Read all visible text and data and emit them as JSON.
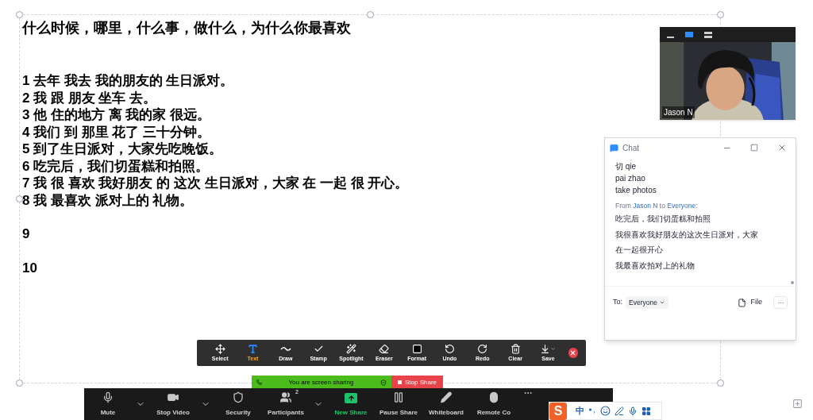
{
  "document": {
    "title": "什么时候，哪里，什么事，做什么，为什么你最喜欢",
    "lines": [
      {
        "kind": "sentence",
        "text": "1 去年 我去 我的朋友的 生日派对。"
      },
      {
        "kind": "sentence",
        "text": "2 我 跟 朋友 坐车 去。"
      },
      {
        "kind": "sentence",
        "text": "3 他 住的地方 离 我的家 很远。"
      },
      {
        "kind": "sentence",
        "text": "4 我们 到 那里 花了 三十分钟。"
      },
      {
        "kind": "sentence",
        "text": "5 到了生日派对，大家先吃晚饭。"
      },
      {
        "kind": "sentence",
        "text": "6 吃完后，我们切蛋糕和拍照。"
      },
      {
        "kind": "sentence",
        "text": "7 我 很 喜欢 我好朋友 的 这次 生日派对，大家 在 一起 很 开心。"
      },
      {
        "kind": "sentence",
        "text": "8 我 最喜欢 派对上的 礼物。"
      },
      {
        "kind": "spaced",
        "text": "9"
      },
      {
        "kind": "spaced",
        "text": "10"
      }
    ]
  },
  "video": {
    "name": "Jason N",
    "view_buttons": [
      {
        "kind": "minimize",
        "selected": false
      },
      {
        "kind": "speaker",
        "selected": true
      },
      {
        "kind": "gallery",
        "selected": false
      }
    ]
  },
  "chat": {
    "title": "Chat",
    "earlier_lines": [
      "切 qie",
      "pai zhao",
      "take photos"
    ],
    "header": {
      "from_label": "From",
      "sender": "Jason N",
      "to_label": "to",
      "recipient": "Everyone:"
    },
    "messages": [
      "吃完后，我们切蛋糕和拍照",
      "我很喜欢我好朋友的这次生日派对，大家",
      "在一起很开心",
      "我最喜欢拍对上的礼物"
    ],
    "footer": {
      "to_label": "To:",
      "recipient": "Everyone",
      "file_label": "File"
    }
  },
  "annotation_toolbar": {
    "tools": [
      {
        "kind": "select",
        "label": "Select",
        "selected": false
      },
      {
        "kind": "text",
        "label": "Text",
        "selected": true
      },
      {
        "kind": "draw",
        "label": "Draw",
        "selected": false
      },
      {
        "kind": "stamp",
        "label": "Stamp",
        "selected": false
      },
      {
        "kind": "spotlight",
        "label": "Spotlight",
        "selected": false
      },
      {
        "kind": "eraser",
        "label": "Eraser",
        "selected": false
      },
      {
        "kind": "format",
        "label": "Format",
        "selected": false
      },
      {
        "kind": "undo",
        "label": "Undo",
        "selected": false
      },
      {
        "kind": "redo",
        "label": "Redo",
        "selected": false
      },
      {
        "kind": "clear",
        "label": "Clear",
        "selected": false
      },
      {
        "kind": "save",
        "label": "Save",
        "selected": false
      }
    ]
  },
  "sharing_banner": {
    "message": "You are screen sharing",
    "stop_label": "Stop Share"
  },
  "meeting_toolbar": {
    "items": [
      {
        "kind": "mute",
        "label": "Mute"
      },
      {
        "kind": "caret"
      },
      {
        "kind": "video",
        "label": "Stop Video"
      },
      {
        "kind": "caret"
      },
      {
        "kind": "security",
        "label": "Security"
      },
      {
        "kind": "participants",
        "label": "Participants",
        "count": "2"
      },
      {
        "kind": "caret"
      },
      {
        "kind": "new_share",
        "label": "New Share"
      },
      {
        "kind": "pause",
        "label": "Pause Share"
      },
      {
        "kind": "whiteboard",
        "label": "Whiteboard"
      },
      {
        "kind": "remote",
        "label": "Remote Co"
      },
      {
        "kind": "more"
      }
    ]
  },
  "ime_bar": {
    "logo": "S",
    "mode": "中"
  }
}
